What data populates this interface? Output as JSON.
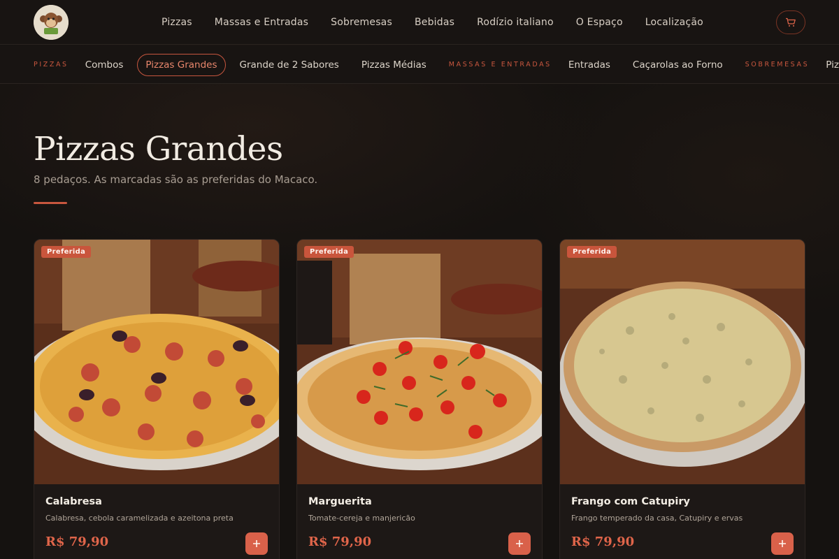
{
  "nav": {
    "logo_alt": "macaco logo",
    "links": [
      "Pizzas",
      "Massas e Entradas",
      "Sobremesas",
      "Bebidas",
      "Rodízio italiano",
      "O Espaço",
      "Localização"
    ],
    "cart_icon": "cart-icon"
  },
  "categories": {
    "pizzas_label": "PIZZAS",
    "massas_label": "MASSAS E ENTRADAS",
    "sobremesas_label": "SOBREMESAS",
    "items": {
      "combos": "Combos",
      "pizzas_grandes": "Pizzas Grandes",
      "grande_2_sabores": "Grande de 2 Sabores",
      "pizzas_medias": "Pizzas Médias",
      "entradas": "Entradas",
      "cacarolas": "Caçarolas ao Forno",
      "pizzas_doces": "Pizzas Doces"
    },
    "active": "Pizzas Grandes"
  },
  "section": {
    "title": "Pizzas Grandes",
    "subtitle": "8 pedaços. As marcadas são as preferidas do Macaco."
  },
  "products": [
    {
      "badge": "Preferida",
      "name": "Calabresa",
      "description": "Calabresa, cebola caramelizada e azeitona preta",
      "price": "R$ 79,90"
    },
    {
      "badge": "Preferida",
      "name": "Marguerita",
      "description": "Tomate-cereja e manjericão",
      "price": "R$ 79,90"
    },
    {
      "badge": "Preferida",
      "name": "Frango com Catupiry",
      "description": "Frango temperado da casa, Catupiry e ervas",
      "price": "R$ 79,90"
    }
  ],
  "colors": {
    "accent": "#c7563e",
    "price": "#e0654a",
    "background": "#151210"
  }
}
